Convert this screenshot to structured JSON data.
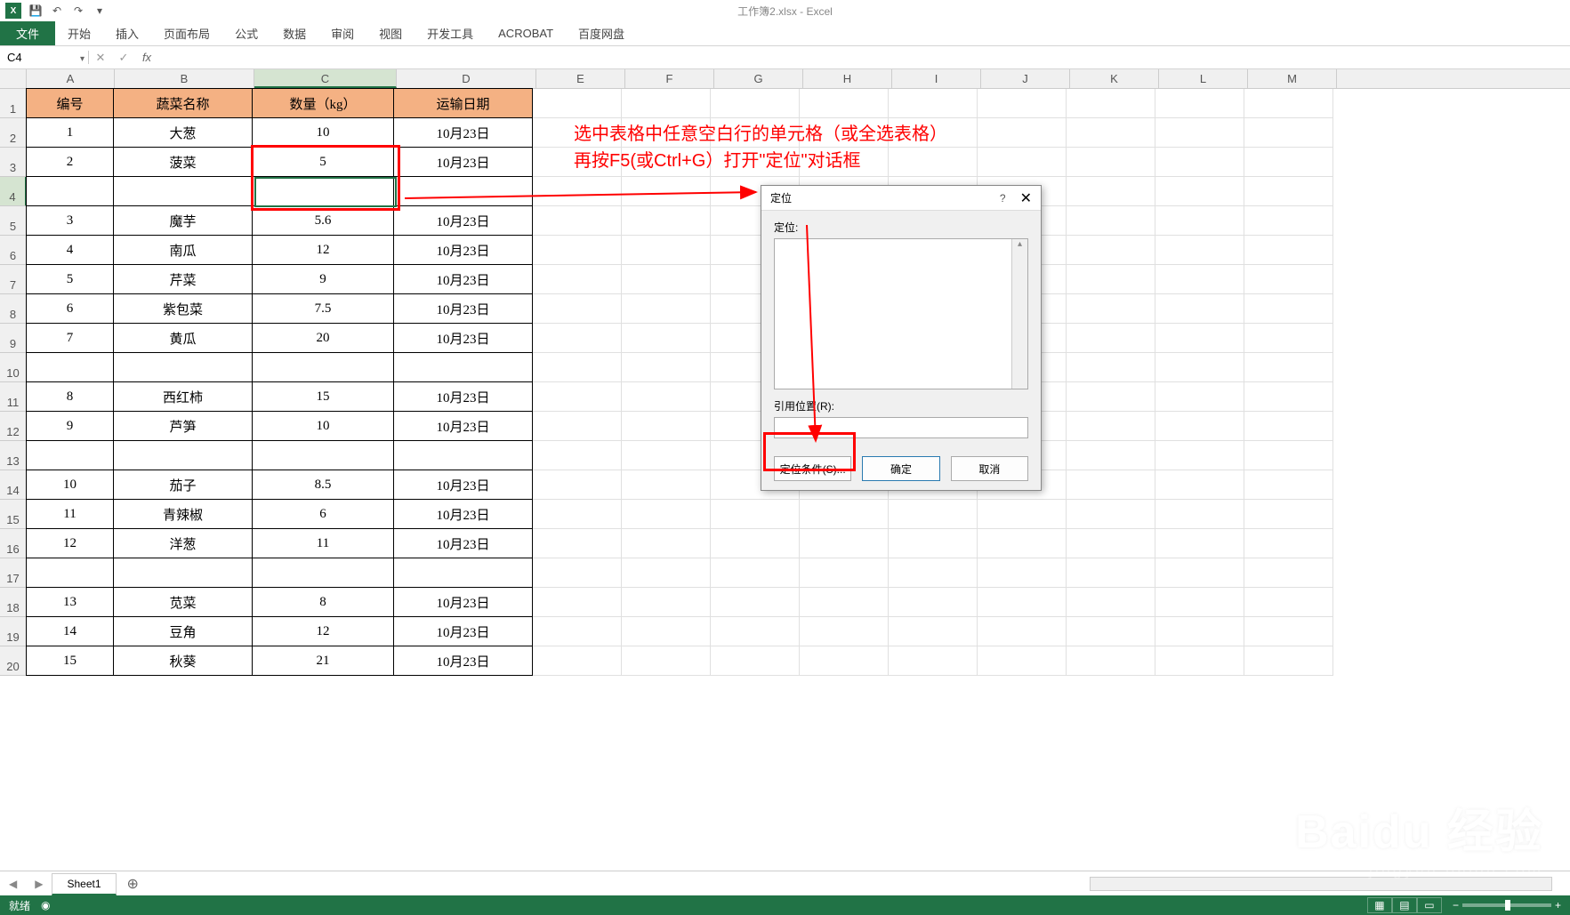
{
  "app": {
    "title": "工作簿2.xlsx - Excel",
    "excel_abbrev": "X"
  },
  "qat": {
    "save": "💾",
    "undo": "↶",
    "redo": "↷",
    "more": "▾"
  },
  "tabs": {
    "file": "文件",
    "home": "开始",
    "insert": "插入",
    "page_layout": "页面布局",
    "formulas": "公式",
    "data": "数据",
    "review": "审阅",
    "view": "视图",
    "developer": "开发工具",
    "acrobat": "ACROBAT",
    "baidu": "百度网盘"
  },
  "formula_bar": {
    "name_box": "C4",
    "cancel": "✕",
    "confirm": "✓",
    "fx": "fx",
    "value": ""
  },
  "columns": [
    "A",
    "B",
    "C",
    "D",
    "E",
    "F",
    "G",
    "H",
    "I",
    "J",
    "K",
    "L",
    "M"
  ],
  "selected_col_index": 2,
  "selected_row_index": 3,
  "headers": [
    "编号",
    "蔬菜名称",
    "数量（kg）",
    "运输日期"
  ],
  "table_rows": [
    [
      "1",
      "大葱",
      "10",
      "10月23日"
    ],
    [
      "2",
      "菠菜",
      "5",
      "10月23日"
    ],
    [
      "",
      "",
      "",
      ""
    ],
    [
      "3",
      "魔芋",
      "5.6",
      "10月23日"
    ],
    [
      "4",
      "南瓜",
      "12",
      "10月23日"
    ],
    [
      "5",
      "芹菜",
      "9",
      "10月23日"
    ],
    [
      "6",
      "紫包菜",
      "7.5",
      "10月23日"
    ],
    [
      "7",
      "黄瓜",
      "20",
      "10月23日"
    ],
    [
      "",
      "",
      "",
      ""
    ],
    [
      "8",
      "西红柿",
      "15",
      "10月23日"
    ],
    [
      "9",
      "芦笋",
      "10",
      "10月23日"
    ],
    [
      "",
      "",
      "",
      ""
    ],
    [
      "10",
      "茄子",
      "8.5",
      "10月23日"
    ],
    [
      "11",
      "青辣椒",
      "6",
      "10月23日"
    ],
    [
      "12",
      "洋葱",
      "11",
      "10月23日"
    ],
    [
      "",
      "",
      "",
      ""
    ],
    [
      "13",
      "苋菜",
      "8",
      "10月23日"
    ],
    [
      "14",
      "豆角",
      "12",
      "10月23日"
    ],
    [
      "15",
      "秋葵",
      "21",
      "10月23日"
    ]
  ],
  "annotation": {
    "line1": "选中表格中任意空白行的单元格（或全选表格）",
    "line2": "再按F5(或Ctrl+G）打开\"定位\"对话框"
  },
  "dialog": {
    "title": "定位",
    "help": "?",
    "close": "✕",
    "list_label": "定位:",
    "ref_label": "引用位置(R):",
    "ref_value": "",
    "btn_special": "定位条件(S)...",
    "btn_ok": "确定",
    "btn_cancel": "取消"
  },
  "sheet_tabs": {
    "nav_prev": "◀",
    "nav_next": "▶",
    "sheet1": "Sheet1",
    "add": "⊕"
  },
  "statusbar": {
    "ready": "就绪",
    "rec": "◉",
    "zoom_minus": "−",
    "zoom_plus": "+",
    "zoom_value": "100%"
  },
  "watermark": {
    "brand": "Baidu 经验",
    "url": "jingyan.baidu.com"
  }
}
